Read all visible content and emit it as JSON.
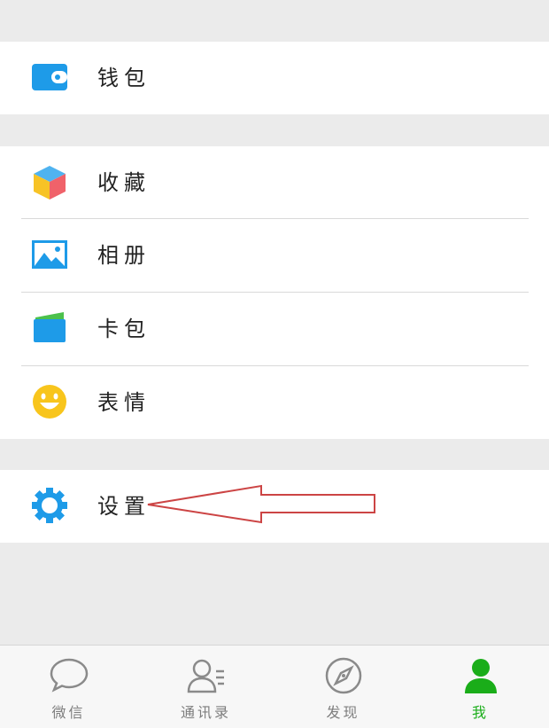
{
  "menu": {
    "wallet_label": "钱包",
    "favorites_label": "收藏",
    "album_label": "相册",
    "cards_label": "卡包",
    "stickers_label": "表情",
    "settings_label": "设置"
  },
  "tabbar": {
    "chats_label": "微信",
    "contacts_label": "通讯录",
    "discover_label": "发现",
    "me_label": "我"
  },
  "colors": {
    "active_tab": "#1aad19",
    "wallet_icon": "#1e9be8",
    "settings_icon": "#1e9be8",
    "annotation_arrow": "#cc4444"
  },
  "icons": {
    "wallet": "wallet-icon",
    "favorites": "cube-icon",
    "album": "picture-icon",
    "cards": "card-icon",
    "stickers": "smiley-icon",
    "settings": "gear-icon",
    "chats": "chat-bubble-icon",
    "contacts": "contacts-icon",
    "discover": "compass-icon",
    "me": "person-icon"
  }
}
